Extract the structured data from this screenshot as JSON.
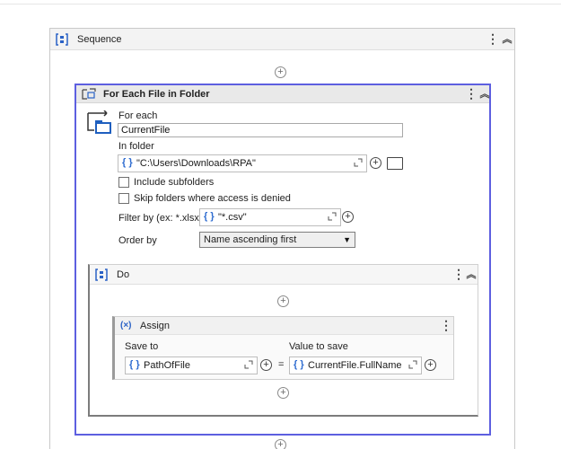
{
  "sequence": {
    "title": "Sequence",
    "icon": "sequence-icon"
  },
  "for_each_file": {
    "title": "For Each File in Folder",
    "for_each_label": "For each",
    "current_item": "CurrentFile",
    "in_folder_label": "In folder",
    "folder_path": "\"C:\\Users\\Downloads\\RPA\"",
    "include_subfolders_label": "Include subfolders",
    "include_subfolders_checked": false,
    "skip_folders_label": "Skip folders where access is denied",
    "skip_folders_checked": false,
    "filter_label": "Filter by (ex: *.xlsx)",
    "filter_value": "\"*.csv\"",
    "order_label": "Order by",
    "order_value": "Name ascending first"
  },
  "do_block": {
    "title": "Do"
  },
  "assign": {
    "title": "Assign",
    "icon_text": "(×)",
    "save_to_label": "Save to",
    "save_to_value": "PathOfFile",
    "equals": "=",
    "value_label": "Value to save",
    "value_value": "CurrentFile.FullName"
  },
  "symbols": {
    "expr": "{ }",
    "plus": "+",
    "more": "⋮",
    "collapse": "︽",
    "expand": "⌜⌟",
    "dropdown_arrow": "▼"
  },
  "colors": {
    "selected_border": "#5d5fe0",
    "icon_blue": "#2b62c6"
  }
}
